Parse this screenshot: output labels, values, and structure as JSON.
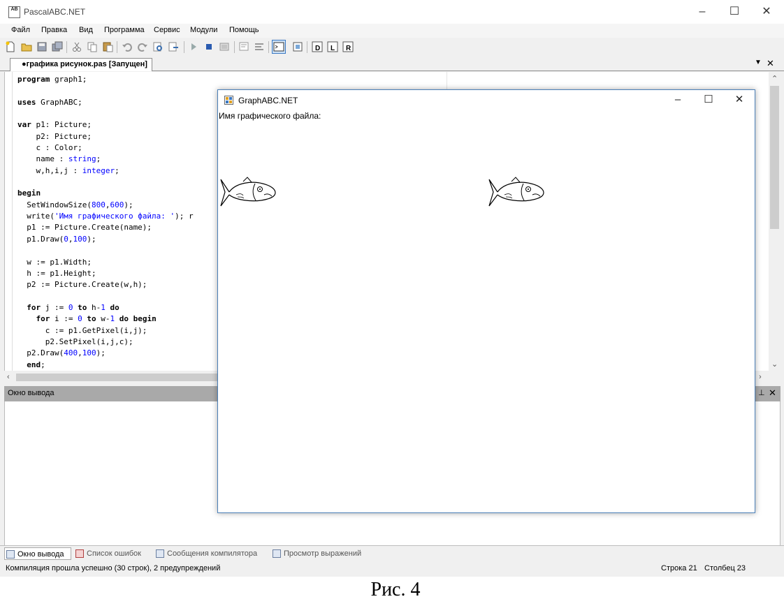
{
  "app": {
    "title": "PascalABC.NET",
    "icon_text": "AB",
    "menu": [
      "Файл",
      "Правка",
      "Вид",
      "Программа",
      "Сервис",
      "Модули",
      "Помощь"
    ]
  },
  "editor": {
    "tab_label": "●графика рисунок.pas [Запущен]",
    "code_lines": [
      [
        [
          "kw",
          "program"
        ],
        [
          "t",
          " graph1;"
        ]
      ],
      [],
      [
        [
          "kw",
          "uses"
        ],
        [
          "t",
          " GraphABC;"
        ]
      ],
      [],
      [
        [
          "kw",
          "var"
        ],
        [
          "t",
          " p1: Picture;"
        ]
      ],
      [
        [
          "t",
          "    p2: Picture;"
        ]
      ],
      [
        [
          "t",
          "    c : Color;"
        ]
      ],
      [
        [
          "t",
          "    name : "
        ],
        [
          "typ",
          "string"
        ],
        [
          "t",
          ";"
        ]
      ],
      [
        [
          "t",
          "    w,h,i,j : "
        ],
        [
          "typ",
          "integer"
        ],
        [
          "t",
          ";"
        ]
      ],
      [],
      [
        [
          "kw",
          "begin"
        ]
      ],
      [
        [
          "t",
          "  SetWindowSize("
        ],
        [
          "num",
          "800"
        ],
        [
          "t",
          ","
        ],
        [
          "num",
          "600"
        ],
        [
          "t",
          ");"
        ]
      ],
      [
        [
          "t",
          "  write("
        ],
        [
          "str",
          "'Имя графического файла: '"
        ],
        [
          "t",
          "); r"
        ]
      ],
      [
        [
          "t",
          "  p1 := Picture.Create(name);"
        ]
      ],
      [
        [
          "t",
          "  p1.Draw("
        ],
        [
          "num",
          "0"
        ],
        [
          "t",
          ","
        ],
        [
          "num",
          "100"
        ],
        [
          "t",
          ");"
        ]
      ],
      [],
      [
        [
          "t",
          "  w := p1.Width;"
        ]
      ],
      [
        [
          "t",
          "  h := p1.Height;"
        ]
      ],
      [
        [
          "t",
          "  p2 := Picture.Create(w,h);"
        ]
      ],
      [],
      [
        [
          "t",
          "  "
        ],
        [
          "kw",
          "for"
        ],
        [
          "t",
          " j := "
        ],
        [
          "num",
          "0"
        ],
        [
          "t",
          " "
        ],
        [
          "kw",
          "to"
        ],
        [
          "t",
          " h-"
        ],
        [
          "num",
          "1"
        ],
        [
          "t",
          " "
        ],
        [
          "kw",
          "do"
        ]
      ],
      [
        [
          "t",
          "    "
        ],
        [
          "kw",
          "for"
        ],
        [
          "t",
          " i := "
        ],
        [
          "num",
          "0"
        ],
        [
          "t",
          " "
        ],
        [
          "kw",
          "to"
        ],
        [
          "t",
          " w-"
        ],
        [
          "num",
          "1"
        ],
        [
          "t",
          " "
        ],
        [
          "kw",
          "do"
        ],
        [
          "t",
          " "
        ],
        [
          "kw",
          "begin"
        ]
      ],
      [
        [
          "t",
          "      c := p1.GetPixel(i,j);"
        ]
      ],
      [
        [
          "t",
          "      p2.SetPixel(i,j,c);"
        ]
      ],
      [
        [
          "t",
          "  p2.Draw("
        ],
        [
          "num",
          "400"
        ],
        [
          "t",
          ","
        ],
        [
          "num",
          "100"
        ],
        [
          "t",
          ");"
        ]
      ],
      [
        [
          "t",
          "  "
        ],
        [
          "kw",
          "end"
        ],
        [
          "t",
          ";"
        ]
      ]
    ]
  },
  "output": {
    "title": "Окно вывода",
    "pin_icon": "pin-icon",
    "close_icon": "close-icon"
  },
  "bottom_tabs": [
    "Окно вывода",
    "Список ошибок",
    "Сообщения компилятора",
    "Просмотр выражений"
  ],
  "status": {
    "message": "Компиляция прошла успешно (30 строк), 2 предупреждений",
    "row": "Строка  21",
    "col": "Столбец  23"
  },
  "graph_window": {
    "title": "GraphABC.NET",
    "prompt": "Имя графического файла:"
  },
  "caption": "Рис. 4"
}
